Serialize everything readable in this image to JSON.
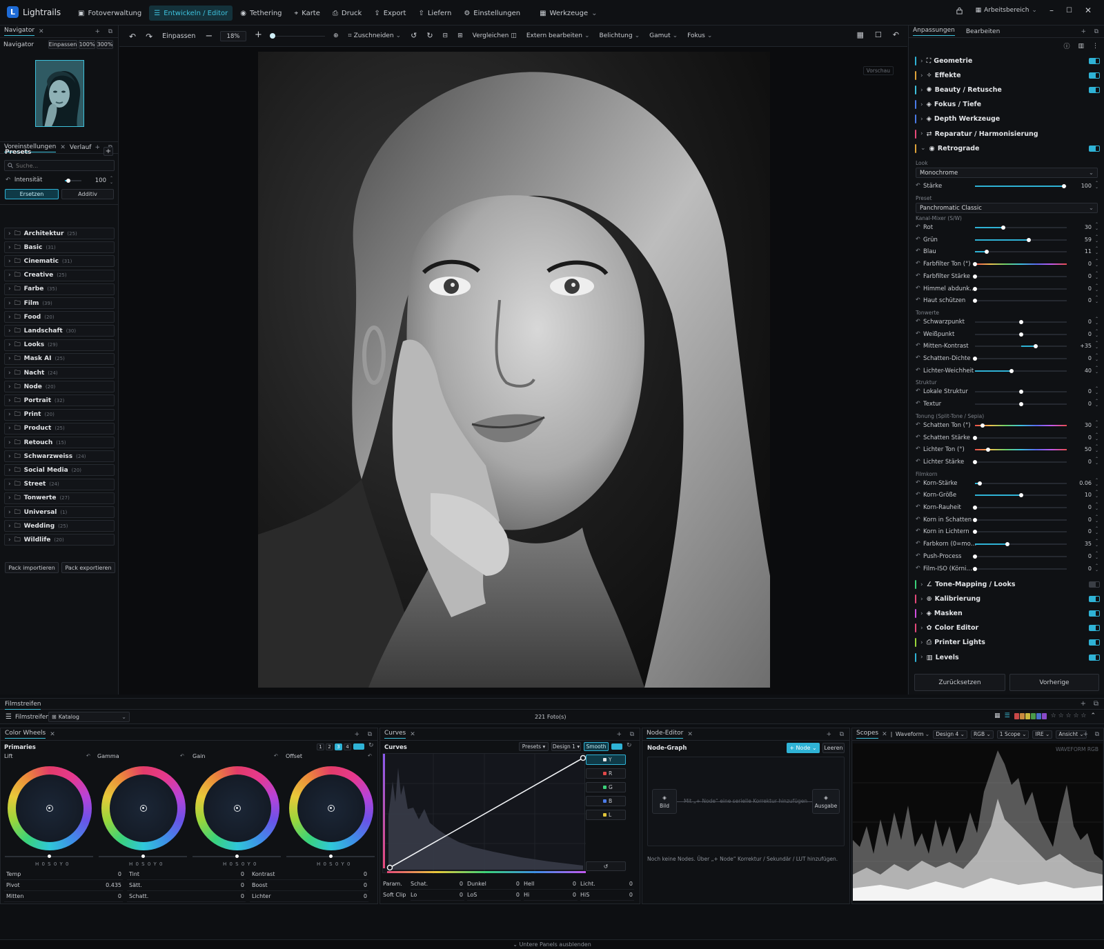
{
  "app": {
    "name": "Lightrails"
  },
  "nav": {
    "items": [
      {
        "label": "Fotoverwaltung",
        "icon": "image-gallery-icon"
      },
      {
        "label": "Entwickeln / Editor",
        "icon": "sliders-icon",
        "active": true
      },
      {
        "label": "Tethering",
        "icon": "camera-icon"
      },
      {
        "label": "Karte",
        "icon": "map-pin-icon"
      },
      {
        "label": "Druck",
        "icon": "printer-icon"
      },
      {
        "label": "Export",
        "icon": "export-icon"
      },
      {
        "label": "Liefern",
        "icon": "upload-icon"
      },
      {
        "label": "Einstellungen",
        "icon": "gear-icon"
      },
      {
        "label": "Werkzeuge",
        "icon": "grid-icon",
        "dropdown": true
      }
    ],
    "workspace": "Arbeitsbereich"
  },
  "navigator": {
    "tab": "Navigator",
    "title": "Navigator",
    "fit": "Einpassen",
    "z100": "100%",
    "z300": "300%"
  },
  "presets": {
    "tab1": "Voreinstellungen",
    "tab2": "Verlauf",
    "title": "Presets",
    "search_placeholder": "Suche...",
    "intensity_label": "Intensität",
    "intensity_value": "100",
    "intensity_level": 0.2,
    "mode_replace": "Ersetzen",
    "mode_additive": "Additiv",
    "folders": [
      {
        "name": "Architektur",
        "count": "(25)"
      },
      {
        "name": "Basic",
        "count": "(31)"
      },
      {
        "name": "Cinematic",
        "count": "(31)"
      },
      {
        "name": "Creative",
        "count": "(25)"
      },
      {
        "name": "Farbe",
        "count": "(35)"
      },
      {
        "name": "Film",
        "count": "(39)"
      },
      {
        "name": "Food",
        "count": "(20)"
      },
      {
        "name": "Landschaft",
        "count": "(30)"
      },
      {
        "name": "Looks",
        "count": "(29)"
      },
      {
        "name": "Mask AI",
        "count": "(25)"
      },
      {
        "name": "Nacht",
        "count": "(24)"
      },
      {
        "name": "Node",
        "count": "(20)"
      },
      {
        "name": "Portrait",
        "count": "(32)"
      },
      {
        "name": "Print",
        "count": "(20)"
      },
      {
        "name": "Product",
        "count": "(25)"
      },
      {
        "name": "Retouch",
        "count": "(15)"
      },
      {
        "name": "Schwarzweiss",
        "count": "(24)"
      },
      {
        "name": "Social Media",
        "count": "(20)"
      },
      {
        "name": "Street",
        "count": "(24)"
      },
      {
        "name": "Tonwerte",
        "count": "(27)"
      },
      {
        "name": "Universal",
        "count": "(1)"
      },
      {
        "name": "Wedding",
        "count": "(25)"
      },
      {
        "name": "Wildlife",
        "count": "(20)"
      }
    ],
    "import": "Pack importieren",
    "export": "Pack exportieren"
  },
  "toolbar": {
    "fit": "Einpassen",
    "zoom": "18%",
    "crop": "Zuschneiden",
    "compare": "Vergleichen",
    "external": "Extern bearbeiten",
    "exposure": "Belichtung",
    "gamut": "Gamut",
    "focus": "Fokus"
  },
  "canvas": {
    "preview_label": "Vorschau"
  },
  "right": {
    "tab1": "Anpassungen",
    "tab2": "Bearbeiten",
    "sections_top": [
      {
        "label": "Geometrie",
        "color": "#2fb3d6",
        "icon": "crop-icon",
        "on": true
      },
      {
        "label": "Effekte",
        "color": "#e0a43a",
        "icon": "sparkle-icon",
        "on": true
      },
      {
        "label": "Beauty / Retusche",
        "color": "#3ec3de",
        "icon": "sun-icon",
        "on": true
      },
      {
        "label": "Fokus / Tiefe",
        "color": "#4b7be8",
        "icon": "layers-icon",
        "on": false
      },
      {
        "label": "Depth Werkzeuge",
        "color": "#4b7be8",
        "icon": "layers-icon",
        "on": false
      },
      {
        "label": "Reparatur / Harmonisierung",
        "color": "#e6497a",
        "icon": "adjust-icon",
        "on": false
      },
      {
        "label": "Retrograde",
        "color": "#e0a43a",
        "icon": "camera-icon",
        "on": true
      }
    ],
    "look_label": "Look",
    "look_value": "Monochrome",
    "strength": {
      "label": "Stärke",
      "value": "100",
      "level": 0.97
    },
    "preset_label": "Preset",
    "preset_value": "Panchromatic Classic",
    "groups": [
      {
        "title": "Kanal-Mixer (S/W)",
        "params": [
          {
            "label": "Rot",
            "value": "30",
            "level": 0.31
          },
          {
            "label": "Grün",
            "value": "59",
            "level": 0.59
          },
          {
            "label": "Blau",
            "value": "11",
            "level": 0.13
          },
          {
            "label": "Farbfilter Ton (°)",
            "value": "0",
            "level": 0.0,
            "rainbow": true
          },
          {
            "label": "Farbfilter Stärke",
            "value": "0",
            "level": 0.0
          },
          {
            "label": "Himmel abdunk…",
            "value": "0",
            "level": 0.0
          },
          {
            "label": "Haut schützen",
            "value": "0",
            "level": 0.0
          }
        ]
      },
      {
        "title": "Tonwerte",
        "params": [
          {
            "label": "Schwarzpunkt",
            "value": "0",
            "level": 0.5,
            "center": true
          },
          {
            "label": "Weißpunkt",
            "value": "0",
            "level": 0.5,
            "center": true
          },
          {
            "label": "Mitten-Kontrast",
            "value": "+35",
            "level": 0.66,
            "center": true
          },
          {
            "label": "Schatten-Dichte",
            "value": "0",
            "level": 0.0
          },
          {
            "label": "Lichter-Weichheit",
            "value": "40",
            "level": 0.4
          }
        ]
      },
      {
        "title": "Struktur",
        "params": [
          {
            "label": "Lokale Struktur",
            "value": "0",
            "level": 0.5,
            "center": true
          },
          {
            "label": "Textur",
            "value": "0",
            "level": 0.5,
            "center": true
          }
        ]
      },
      {
        "title": "Tonung (Split-Tone / Sepia)",
        "params": [
          {
            "label": "Schatten Ton (°)",
            "value": "30",
            "level": 0.08,
            "rainbow": true
          },
          {
            "label": "Schatten Stärke",
            "value": "0",
            "level": 0.0
          },
          {
            "label": "Lichter Ton (°)",
            "value": "50",
            "level": 0.14,
            "rainbow": true
          },
          {
            "label": "Lichter Stärke",
            "value": "0",
            "level": 0.0
          }
        ]
      },
      {
        "title": "Filmkorn",
        "params": [
          {
            "label": "Korn-Stärke",
            "value": "0.06",
            "level": 0.05
          },
          {
            "label": "Korn-Größe",
            "value": "10",
            "level": 0.5
          },
          {
            "label": "Korn-Rauheit",
            "value": "0",
            "level": 0.0
          },
          {
            "label": "Korn in Schatten",
            "value": "0",
            "level": 0.0
          },
          {
            "label": "Korn in Lichtern",
            "value": "0",
            "level": 0.0
          },
          {
            "label": "Farbkorn (0=mo…",
            "value": "35",
            "level": 0.35
          },
          {
            "label": "Push-Process",
            "value": "0",
            "level": 0.0
          },
          {
            "label": "Film-ISO (Körni…",
            "value": "0",
            "level": 0.0
          }
        ]
      }
    ],
    "sections_bottom": [
      {
        "label": "Tone-Mapping / Looks",
        "color": "#3bd27a",
        "icon": "chart-icon",
        "on": false
      },
      {
        "label": "Kalibrierung",
        "color": "#e6497a",
        "icon": "target-icon",
        "on": true
      },
      {
        "label": "Masken",
        "color": "#d04fe0",
        "icon": "layers-icon",
        "on": true
      },
      {
        "label": "Color Editor",
        "color": "#e6497a",
        "icon": "palette-icon",
        "on": true
      },
      {
        "label": "Printer Lights",
        "color": "#9ad63b",
        "icon": "printer-icon",
        "on": true
      },
      {
        "label": "Levels",
        "color": "#2fb3d6",
        "icon": "levels-icon",
        "on": true
      }
    ],
    "reset": "Zurücksetzen",
    "previous": "Vorherige"
  },
  "filmstrip": {
    "tab": "Filmstreifen",
    "title": "Filmstreifen",
    "catalog": "Katalog",
    "count": "221 Foto(s)",
    "swatches": [
      "#c94848",
      "#c98a3e",
      "#c9b83e",
      "#4a9a4a",
      "#4a6fc9",
      "#8a4ac9"
    ]
  },
  "colorwheels": {
    "tab": "Color Wheels",
    "title": "Primaries",
    "pages": [
      "1",
      "2",
      "3",
      "4"
    ],
    "wheels": [
      {
        "label": "Lift",
        "readout": "H 0 S 0 Y 0"
      },
      {
        "label": "Gamma",
        "readout": "H 0 S 0 Y 0"
      },
      {
        "label": "Gain",
        "readout": "H 0 S 0 Y 0"
      },
      {
        "label": "Offset",
        "readout": "H 0 S 0 Y 0"
      }
    ],
    "table": [
      [
        {
          "l": "Temp",
          "v": "0"
        },
        {
          "l": "Tint",
          "v": "0"
        },
        {
          "l": "Kontrast",
          "v": "0"
        }
      ],
      [
        {
          "l": "Pivot",
          "v": "0.435"
        },
        {
          "l": "Sätt.",
          "v": "0"
        },
        {
          "l": "Boost",
          "v": "0"
        }
      ],
      [
        {
          "l": "Mitten",
          "v": "0"
        },
        {
          "l": "Schatt.",
          "v": "0"
        },
        {
          "l": "Lichter",
          "v": "0"
        }
      ]
    ]
  },
  "curves": {
    "tab": "Curves",
    "title": "Curves",
    "presets": "Presets",
    "design": "Design 1",
    "smooth": "Smooth",
    "channels": [
      {
        "label": "Y",
        "color": "#e6e8eb"
      },
      {
        "label": "R",
        "color": "#e04848"
      },
      {
        "label": "G",
        "color": "#3bd27a"
      },
      {
        "label": "B",
        "color": "#4b7be8"
      },
      {
        "label": "L",
        "color": "#e0c43a"
      }
    ],
    "row1": [
      {
        "l": "Param.",
        "v": ""
      },
      {
        "l": "Schat.",
        "v": "0"
      },
      {
        "l": "Dunkel",
        "v": "0"
      },
      {
        "l": "Hell",
        "v": "0"
      },
      {
        "l": "Licht.",
        "v": "0"
      }
    ],
    "row2": [
      {
        "l": "Soft Clip",
        "v": ""
      },
      {
        "l": "Lo",
        "v": "0"
      },
      {
        "l": "LoS",
        "v": "0"
      },
      {
        "l": "Hi",
        "v": "0"
      },
      {
        "l": "HiS",
        "v": "0"
      }
    ]
  },
  "nodes": {
    "tab": "Node-Editor",
    "title": "Node-Graph",
    "add": "+ Node",
    "clear": "Leeren",
    "input": "Bild",
    "output": "Ausgabe",
    "hint": "Mit „+ Node“ eine serielle Korrektur hinzufügen",
    "empty": "Noch keine Nodes. Über „+ Node“ Korrektur / Sekundär / LUT hinzufügen."
  },
  "scopes": {
    "tab": "Scopes",
    "mode": "Waveform",
    "design": "Design 4",
    "channel": "RGB",
    "count": "1 Scope",
    "unit": "IRE",
    "view": "Ansicht",
    "label": "WAVEFORM RGB"
  },
  "status": {
    "hide_panels": "Untere Panels ausblenden"
  }
}
